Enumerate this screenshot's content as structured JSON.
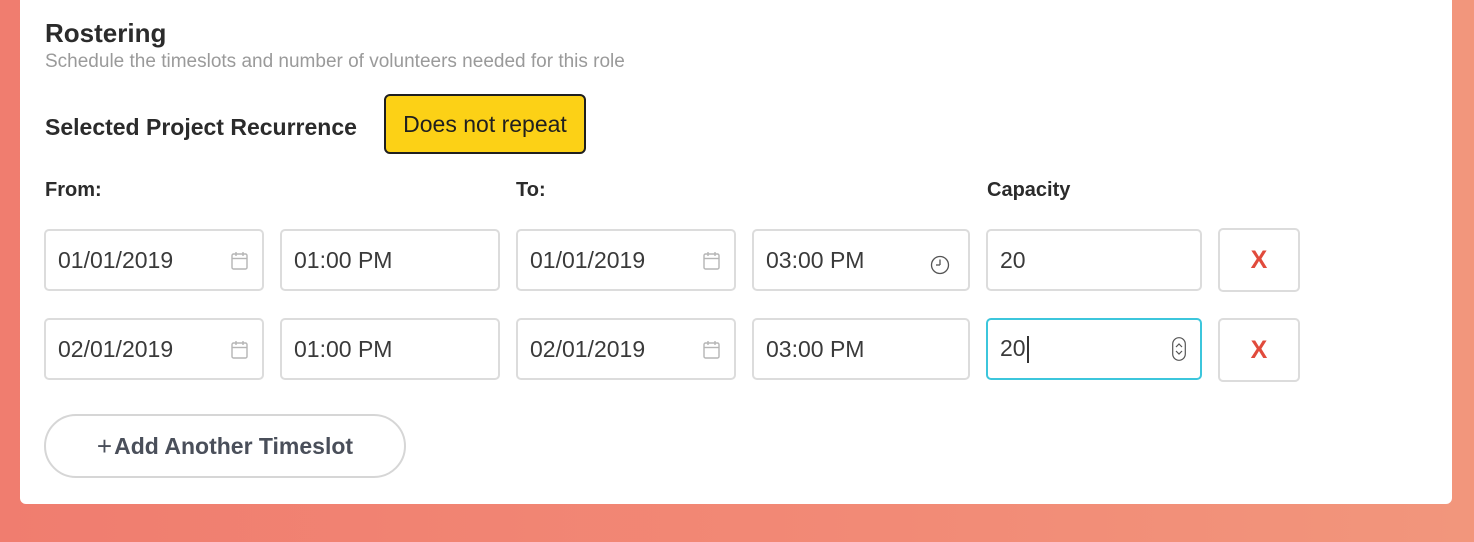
{
  "section": {
    "title": "Rostering",
    "subtitle": "Schedule the timeslots and number of volunteers needed for this role"
  },
  "recurrence": {
    "label": "Selected Project Recurrence",
    "value": "Does not repeat"
  },
  "columns": {
    "from": "From:",
    "to": "To:",
    "capacity": "Capacity"
  },
  "timeslots": [
    {
      "from_date": "01/01/2019",
      "from_time": "01:00 PM",
      "to_date": "01/01/2019",
      "to_time": "03:00 PM",
      "capacity": "20",
      "remove_label": "X"
    },
    {
      "from_date": "02/01/2019",
      "from_time": "01:00 PM",
      "to_date": "02/01/2019",
      "to_time": "03:00 PM",
      "capacity": "20",
      "remove_label": "X"
    }
  ],
  "add_button": {
    "icon": "+",
    "label": "Add Another Timeslot"
  },
  "colors": {
    "recurrence_badge": "#fcd116",
    "remove_x": "#e14b3c",
    "focus_border": "#3cc6dc",
    "background_gradient_start": "#f07d6f",
    "background_gradient_end": "#f2967c"
  },
  "icons": {
    "date_fields": "calendar-icon",
    "focused_time_field": "clock-icon",
    "focused_number_field": "spinner-icon"
  }
}
